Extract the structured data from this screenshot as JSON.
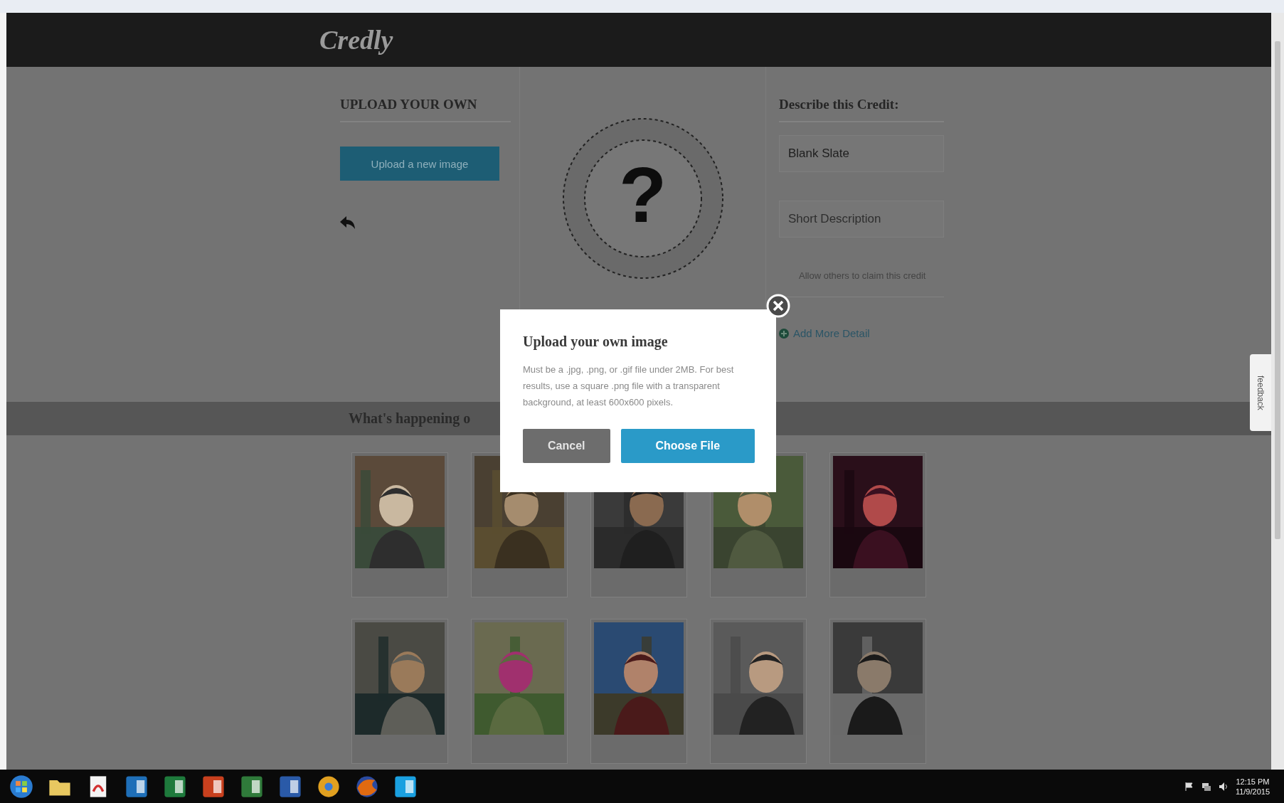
{
  "logo": "Credly",
  "upload_panel": {
    "heading": "UPLOAD YOUR OWN",
    "button": "Upload a new image"
  },
  "badge_preview": {
    "symbol": "?"
  },
  "describe_panel": {
    "heading": "Describe this Credit:",
    "title_field": {
      "value": "Blank Slate"
    },
    "description_field": {
      "placeholder": "Short Description"
    },
    "claim_option": "Allow others to claim this credit",
    "more_link": "Add More Detail"
  },
  "activity": {
    "heading": "What's happening o"
  },
  "modal": {
    "title": "Upload your own image",
    "body": "Must be a .jpg, .png, or .gif file under 2MB. For best results, use a square .png file with a transparent background, at least 600x600 pixels.",
    "buttons": [
      {
        "label": "Cancel",
        "kind": "secondary"
      },
      {
        "label": "Choose File",
        "kind": "primary"
      }
    ]
  },
  "feedback_tab": "feedback",
  "taskbar": {
    "time": "12:15 PM",
    "date": "11/9/2015"
  }
}
